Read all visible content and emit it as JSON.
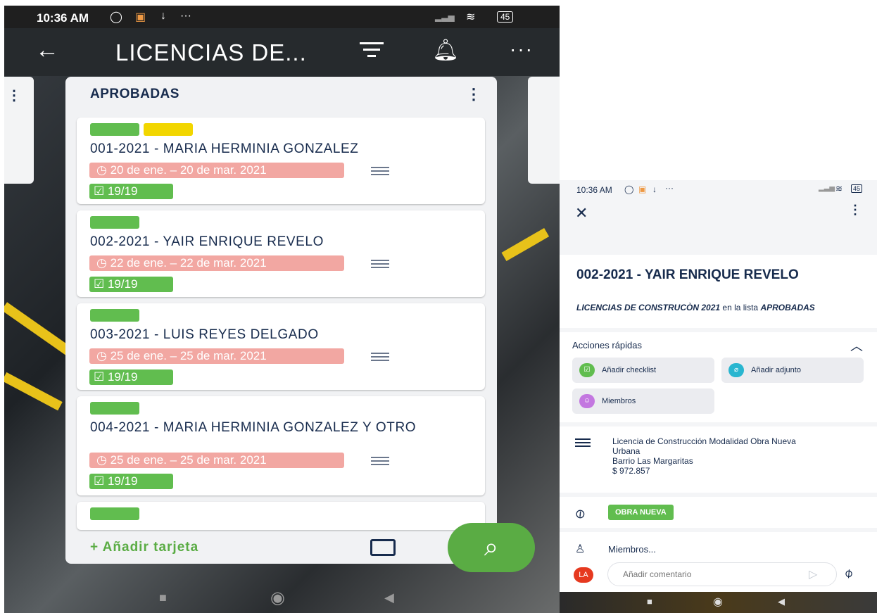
{
  "left": {
    "status": {
      "time": "10:36 AM",
      "battery": "45"
    },
    "appbar": {
      "back_icon": "arrow-left-icon",
      "title": "LICENCIAS DE...",
      "filter_icon": "filter-icon",
      "bell_icon": "bell-icon",
      "more_icon": "more-horizontal-icon"
    },
    "list": {
      "title": "APROBADAS",
      "add_card": "+ Añadir tarjeta",
      "cards": [
        {
          "title": "001-2021 - MARIA HERMINIA GONZALEZ",
          "due": "20 de ene. – 20 de mar. 2021",
          "checklist": "19/19",
          "labels": [
            "#61bd4f",
            "#f2d600"
          ]
        },
        {
          "title": "002-2021 - YAIR ENRIQUE REVELO",
          "due": "22 de ene. – 22 de mar. 2021",
          "checklist": "19/19",
          "labels": [
            "#61bd4f"
          ]
        },
        {
          "title": "003-2021 - LUIS REYES DELGADO",
          "due": "25 de ene. – 25 de mar. 2021",
          "checklist": "19/19",
          "labels": [
            "#61bd4f"
          ]
        },
        {
          "title": "004-2021 - MARIA HERMINIA GONZALEZ Y OTRO",
          "due": "25 de ene. – 25 de mar. 2021",
          "checklist": "19/19",
          "labels": [
            "#61bd4f"
          ]
        }
      ]
    }
  },
  "right": {
    "status": {
      "time": "10:36 AM",
      "battery": "45"
    },
    "card": {
      "title": "002-2021 - YAIR ENRIQUE REVELO",
      "board": "LICENCIAS DE CONSTRUCÒN 2021",
      "in_list": "en la lista",
      "list": "APROBADAS"
    },
    "quick_actions": {
      "title": "Acciones rápidas",
      "checklist": "Añadir checklist",
      "attachment": "Añadir adjunto",
      "members": "Miembros"
    },
    "description": [
      "Licencia de Construcción Modalidad Obra Nueva",
      "Urbana",
      "Barrio Las Margaritas",
      "$ 972.857"
    ],
    "label_tag": "OBRA NUEVA",
    "members_row": "Miembros...",
    "avatar": "LA",
    "comment_placeholder": "Añadir comentario"
  },
  "colors": {
    "green": "#61bd4f",
    "yellow": "#f2d600",
    "due": "#f2a7a2",
    "text": "#172b4d",
    "fab": "#5aac44"
  }
}
